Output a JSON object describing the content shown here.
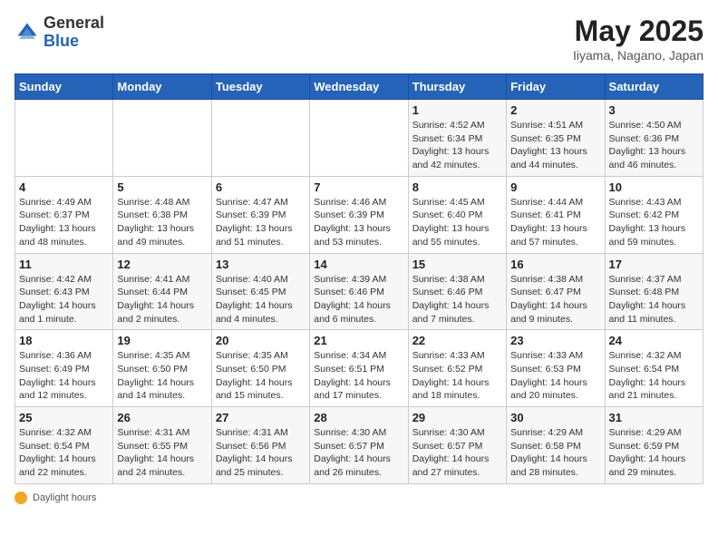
{
  "logo": {
    "general": "General",
    "blue": "Blue"
  },
  "title": "May 2025",
  "subtitle": "Iiyama, Nagano, Japan",
  "weekdays": [
    "Sunday",
    "Monday",
    "Tuesday",
    "Wednesday",
    "Thursday",
    "Friday",
    "Saturday"
  ],
  "weeks": [
    [
      {
        "day": "",
        "info": ""
      },
      {
        "day": "",
        "info": ""
      },
      {
        "day": "",
        "info": ""
      },
      {
        "day": "",
        "info": ""
      },
      {
        "day": "1",
        "info": "Sunrise: 4:52 AM\nSunset: 6:34 PM\nDaylight: 13 hours and 42 minutes."
      },
      {
        "day": "2",
        "info": "Sunrise: 4:51 AM\nSunset: 6:35 PM\nDaylight: 13 hours and 44 minutes."
      },
      {
        "day": "3",
        "info": "Sunrise: 4:50 AM\nSunset: 6:36 PM\nDaylight: 13 hours and 46 minutes."
      }
    ],
    [
      {
        "day": "4",
        "info": "Sunrise: 4:49 AM\nSunset: 6:37 PM\nDaylight: 13 hours and 48 minutes."
      },
      {
        "day": "5",
        "info": "Sunrise: 4:48 AM\nSunset: 6:38 PM\nDaylight: 13 hours and 49 minutes."
      },
      {
        "day": "6",
        "info": "Sunrise: 4:47 AM\nSunset: 6:39 PM\nDaylight: 13 hours and 51 minutes."
      },
      {
        "day": "7",
        "info": "Sunrise: 4:46 AM\nSunset: 6:39 PM\nDaylight: 13 hours and 53 minutes."
      },
      {
        "day": "8",
        "info": "Sunrise: 4:45 AM\nSunset: 6:40 PM\nDaylight: 13 hours and 55 minutes."
      },
      {
        "day": "9",
        "info": "Sunrise: 4:44 AM\nSunset: 6:41 PM\nDaylight: 13 hours and 57 minutes."
      },
      {
        "day": "10",
        "info": "Sunrise: 4:43 AM\nSunset: 6:42 PM\nDaylight: 13 hours and 59 minutes."
      }
    ],
    [
      {
        "day": "11",
        "info": "Sunrise: 4:42 AM\nSunset: 6:43 PM\nDaylight: 14 hours and 1 minute."
      },
      {
        "day": "12",
        "info": "Sunrise: 4:41 AM\nSunset: 6:44 PM\nDaylight: 14 hours and 2 minutes."
      },
      {
        "day": "13",
        "info": "Sunrise: 4:40 AM\nSunset: 6:45 PM\nDaylight: 14 hours and 4 minutes."
      },
      {
        "day": "14",
        "info": "Sunrise: 4:39 AM\nSunset: 6:46 PM\nDaylight: 14 hours and 6 minutes."
      },
      {
        "day": "15",
        "info": "Sunrise: 4:38 AM\nSunset: 6:46 PM\nDaylight: 14 hours and 7 minutes."
      },
      {
        "day": "16",
        "info": "Sunrise: 4:38 AM\nSunset: 6:47 PM\nDaylight: 14 hours and 9 minutes."
      },
      {
        "day": "17",
        "info": "Sunrise: 4:37 AM\nSunset: 6:48 PM\nDaylight: 14 hours and 11 minutes."
      }
    ],
    [
      {
        "day": "18",
        "info": "Sunrise: 4:36 AM\nSunset: 6:49 PM\nDaylight: 14 hours and 12 minutes."
      },
      {
        "day": "19",
        "info": "Sunrise: 4:35 AM\nSunset: 6:50 PM\nDaylight: 14 hours and 14 minutes."
      },
      {
        "day": "20",
        "info": "Sunrise: 4:35 AM\nSunset: 6:50 PM\nDaylight: 14 hours and 15 minutes."
      },
      {
        "day": "21",
        "info": "Sunrise: 4:34 AM\nSunset: 6:51 PM\nDaylight: 14 hours and 17 minutes."
      },
      {
        "day": "22",
        "info": "Sunrise: 4:33 AM\nSunset: 6:52 PM\nDaylight: 14 hours and 18 minutes."
      },
      {
        "day": "23",
        "info": "Sunrise: 4:33 AM\nSunset: 6:53 PM\nDaylight: 14 hours and 20 minutes."
      },
      {
        "day": "24",
        "info": "Sunrise: 4:32 AM\nSunset: 6:54 PM\nDaylight: 14 hours and 21 minutes."
      }
    ],
    [
      {
        "day": "25",
        "info": "Sunrise: 4:32 AM\nSunset: 6:54 PM\nDaylight: 14 hours and 22 minutes."
      },
      {
        "day": "26",
        "info": "Sunrise: 4:31 AM\nSunset: 6:55 PM\nDaylight: 14 hours and 24 minutes."
      },
      {
        "day": "27",
        "info": "Sunrise: 4:31 AM\nSunset: 6:56 PM\nDaylight: 14 hours and 25 minutes."
      },
      {
        "day": "28",
        "info": "Sunrise: 4:30 AM\nSunset: 6:57 PM\nDaylight: 14 hours and 26 minutes."
      },
      {
        "day": "29",
        "info": "Sunrise: 4:30 AM\nSunset: 6:57 PM\nDaylight: 14 hours and 27 minutes."
      },
      {
        "day": "30",
        "info": "Sunrise: 4:29 AM\nSunset: 6:58 PM\nDaylight: 14 hours and 28 minutes."
      },
      {
        "day": "31",
        "info": "Sunrise: 4:29 AM\nSunset: 6:59 PM\nDaylight: 14 hours and 29 minutes."
      }
    ]
  ],
  "footer": {
    "daylight_label": "Daylight hours"
  }
}
